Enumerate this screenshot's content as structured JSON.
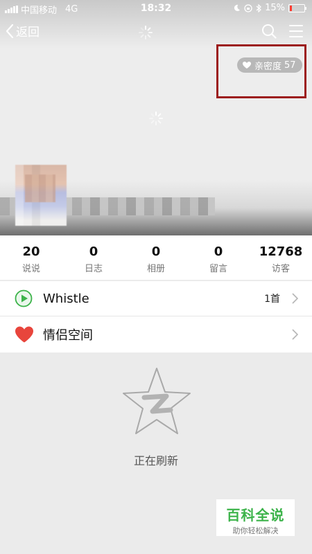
{
  "status_bar": {
    "carrier": "中国移动",
    "network": "4G",
    "time": "18:32",
    "battery": "15%",
    "battery_level": 0.15
  },
  "nav": {
    "back_label": "返回"
  },
  "intimacy": {
    "label": "亲密度",
    "value": "57"
  },
  "stats": [
    {
      "value": "20",
      "label": "说说"
    },
    {
      "value": "0",
      "label": "日志"
    },
    {
      "value": "0",
      "label": "相册"
    },
    {
      "value": "0",
      "label": "留言"
    },
    {
      "value": "12768",
      "label": "访客"
    }
  ],
  "music": {
    "title": "Whistle",
    "count": "1首"
  },
  "couple_space": {
    "title": "情侣空间"
  },
  "loading_text": "正在刷新",
  "watermark": {
    "title": "百科全说",
    "subtitle": "助你轻松解决"
  },
  "colors": {
    "accent_green": "#3cb34a",
    "heart_red": "#e8453c",
    "highlight_red": "#9c1c1c"
  }
}
